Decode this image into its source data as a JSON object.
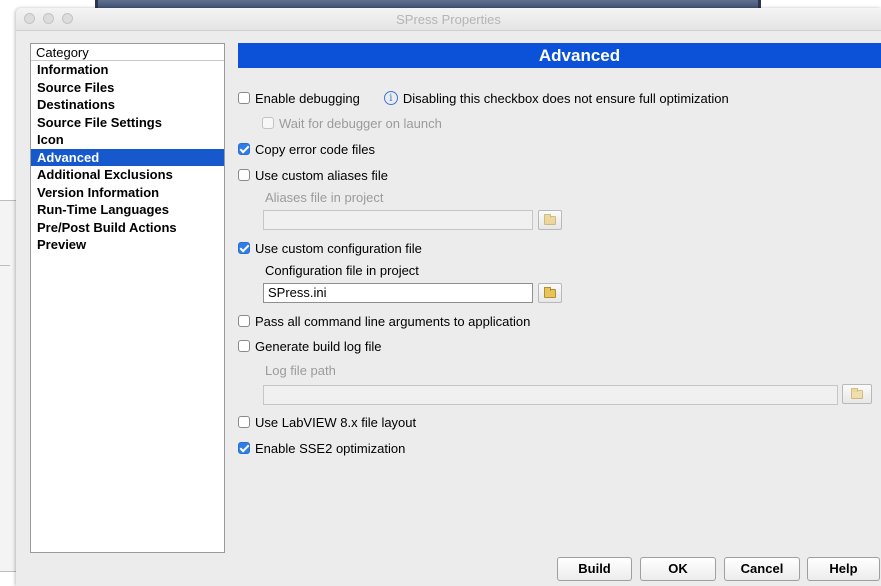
{
  "window": {
    "title": "SPress Properties"
  },
  "category": {
    "header": "Category",
    "items": [
      {
        "label": "Information",
        "selected": false
      },
      {
        "label": "Source Files",
        "selected": false
      },
      {
        "label": "Destinations",
        "selected": false
      },
      {
        "label": "Source File Settings",
        "selected": false
      },
      {
        "label": "Icon",
        "selected": false
      },
      {
        "label": "Advanced",
        "selected": true
      },
      {
        "label": "Additional Exclusions",
        "selected": false
      },
      {
        "label": "Version Information",
        "selected": false
      },
      {
        "label": "Run-Time Languages",
        "selected": false
      },
      {
        "label": "Pre/Post Build Actions",
        "selected": false
      },
      {
        "label": "Preview",
        "selected": false
      }
    ]
  },
  "advanced": {
    "title": "Advanced",
    "enable_debugging": {
      "label": "Enable debugging",
      "checked": false
    },
    "info_note": "Disabling this checkbox does not ensure full optimization",
    "wait_for_debugger": {
      "label": "Wait for debugger on launch",
      "checked": false,
      "enabled": false
    },
    "copy_error_code_files": {
      "label": "Copy error code files",
      "checked": true
    },
    "use_custom_aliases": {
      "label": "Use custom aliases file",
      "checked": false
    },
    "aliases_file_label": "Aliases file in project",
    "aliases_file_value": "",
    "use_custom_config": {
      "label": "Use custom configuration file",
      "checked": true
    },
    "config_file_label": "Configuration file in project",
    "config_file_value": "SPress.ini",
    "pass_all_args": {
      "label": "Pass all command line arguments to application",
      "checked": false
    },
    "generate_build_log": {
      "label": "Generate build log file",
      "checked": false
    },
    "log_file_path_label": "Log file path",
    "log_file_path_value": "",
    "use_labview_layout": {
      "label": "Use LabVIEW 8.x file layout",
      "checked": false
    },
    "enable_sse2": {
      "label": "Enable SSE2 optimization",
      "checked": true
    }
  },
  "buttons": {
    "build": "Build",
    "ok": "OK",
    "cancel": "Cancel",
    "help": "Help"
  },
  "colors": {
    "accent": "#0b52d8",
    "selection": "#1559cd",
    "checkbox_checked": "#2f7de8"
  }
}
